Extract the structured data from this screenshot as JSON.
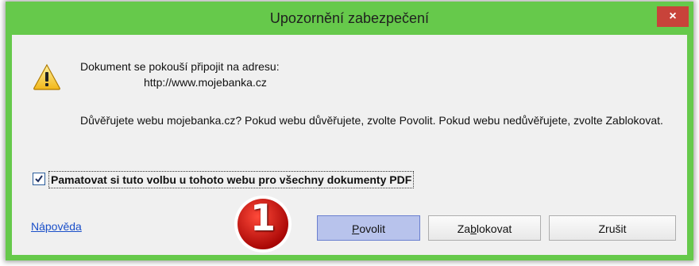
{
  "window": {
    "title": "Upozornění zabezpečení",
    "close_label": "×",
    "colors": {
      "frame": "#66c94b",
      "close": "#c8433a",
      "default_button": "#b8c3ec"
    }
  },
  "icon": {
    "warning": "warning-triangle-icon"
  },
  "message": {
    "line1": "Dokument se pokouší připojit na adresu:",
    "url": "http://www.mojebanka.cz",
    "line2": "Důvěřujete webu mojebanka.cz? Pokud webu důvěřujete, zvolte Povolit. Pokud webu nedůvěřujete, zvolte Zablokovat."
  },
  "remember": {
    "label": "Pamatovat si tuto volbu u tohoto webu pro všechny dokumenty PDF",
    "checked": true
  },
  "help": {
    "label": "Nápověda"
  },
  "buttons": {
    "allow": {
      "pre": "",
      "key": "P",
      "post": "ovolit"
    },
    "block": {
      "pre": "Za",
      "key": "b",
      "post": "lokovat"
    },
    "cancel": {
      "label": "Zrušit"
    }
  },
  "annotation": {
    "number": "1"
  }
}
